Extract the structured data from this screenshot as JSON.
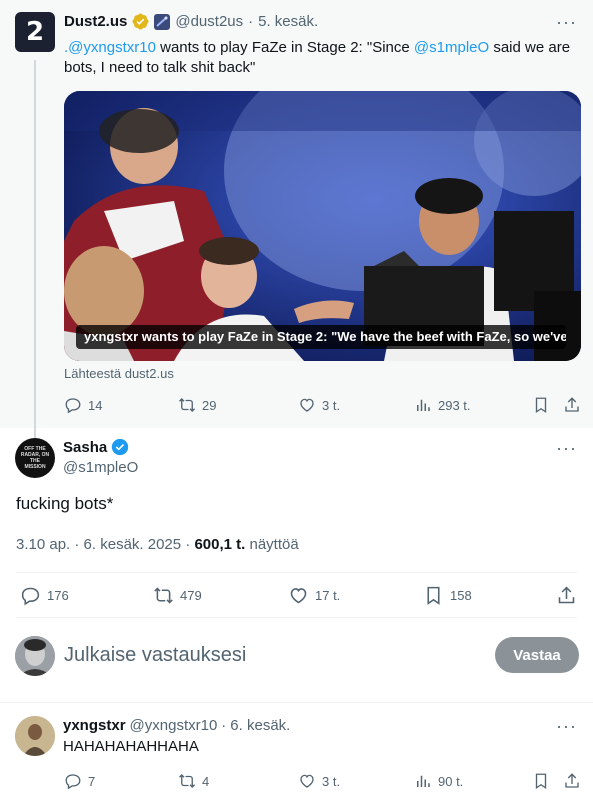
{
  "quoted_tweet": {
    "display_name": "Dust2.us",
    "handle": "@dust2us",
    "separator": "·",
    "date": "5. kesäk.",
    "more": "···",
    "text_mention": ".@yxngstxr10",
    "text_part1": " wants to play FaZe in Stage 2: \"Since ",
    "text_mention2": "@s1mpleO",
    "text_part2": " said we are bots, I need to talk shit back\"",
    "media_caption": "yxngstxr wants to play FaZe in Stage 2: \"We have the beef with FaZe, so we've ...",
    "source": "Lähteestä dust2.us",
    "avatar_text": "2",
    "replies": "14",
    "retweets": "29",
    "likes": "3 t.",
    "views": "293 t."
  },
  "main_tweet": {
    "display_name": "Sasha",
    "handle": "@s1mpleO",
    "more": "···",
    "text": "fucking bots*",
    "timestamp": "3.10 ap. · 6. kesäk. 2025 · ",
    "views_count": "600,1 t.",
    "views_label": " näyttöä",
    "avatar_text": "OFF THE RADAR, ON THE MISSION",
    "replies": "176",
    "retweets": "479",
    "likes": "17 t.",
    "bookmarks": "158"
  },
  "compose": {
    "placeholder": "Julkaise vastauksesi",
    "button": "Vastaa"
  },
  "reply_tweet": {
    "display_name": "yxngstxr",
    "handle": "@yxngstxr10",
    "separator": "·",
    "date": "6. kesäk.",
    "more": "···",
    "text": "HAHAHAHAHHAHA",
    "replies": "7",
    "retweets": "4",
    "likes": "3 t.",
    "views": "90 t."
  },
  "colors": {
    "accent": "#1d9bf0",
    "muted": "#536471",
    "gold_badge": "#e2b719",
    "button_disabled": "#8b9398"
  },
  "icons": [
    "reply-icon",
    "retweet-icon",
    "like-icon",
    "views-icon",
    "bookmark-icon",
    "share-icon",
    "verified-icon",
    "more-icon"
  ]
}
